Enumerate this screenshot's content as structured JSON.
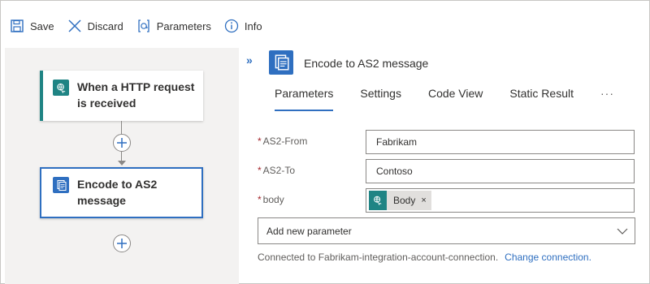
{
  "toolbar": {
    "save_label": "Save",
    "discard_label": "Discard",
    "parameters_label": "Parameters",
    "info_label": "Info"
  },
  "designer": {
    "trigger_title": "When a HTTP request is received",
    "action_title": "Encode to AS2 message"
  },
  "panel": {
    "title": "Encode to AS2 message",
    "tabs": [
      {
        "label": "Parameters",
        "active": true
      },
      {
        "label": "Settings",
        "active": false
      },
      {
        "label": "Code View",
        "active": false
      },
      {
        "label": "Static Result",
        "active": false
      }
    ],
    "more_label": "···",
    "fields": {
      "as2_from": {
        "label": "AS2-From",
        "value": "Fabrikam",
        "required": true
      },
      "as2_to": {
        "label": "AS2-To",
        "value": "Contoso",
        "required": true
      },
      "body": {
        "label": "body",
        "required": true,
        "token": "Body"
      }
    },
    "required_marker": "*",
    "token_close": "×",
    "add_parameter_placeholder": "Add new parameter",
    "connection_text": "Connected to Fabrikam-integration-account-connection.",
    "change_connection_label": "Change connection."
  },
  "colors": {
    "accent": "#2f6fc0",
    "teal": "#1f8484",
    "required": "#a4262c"
  }
}
